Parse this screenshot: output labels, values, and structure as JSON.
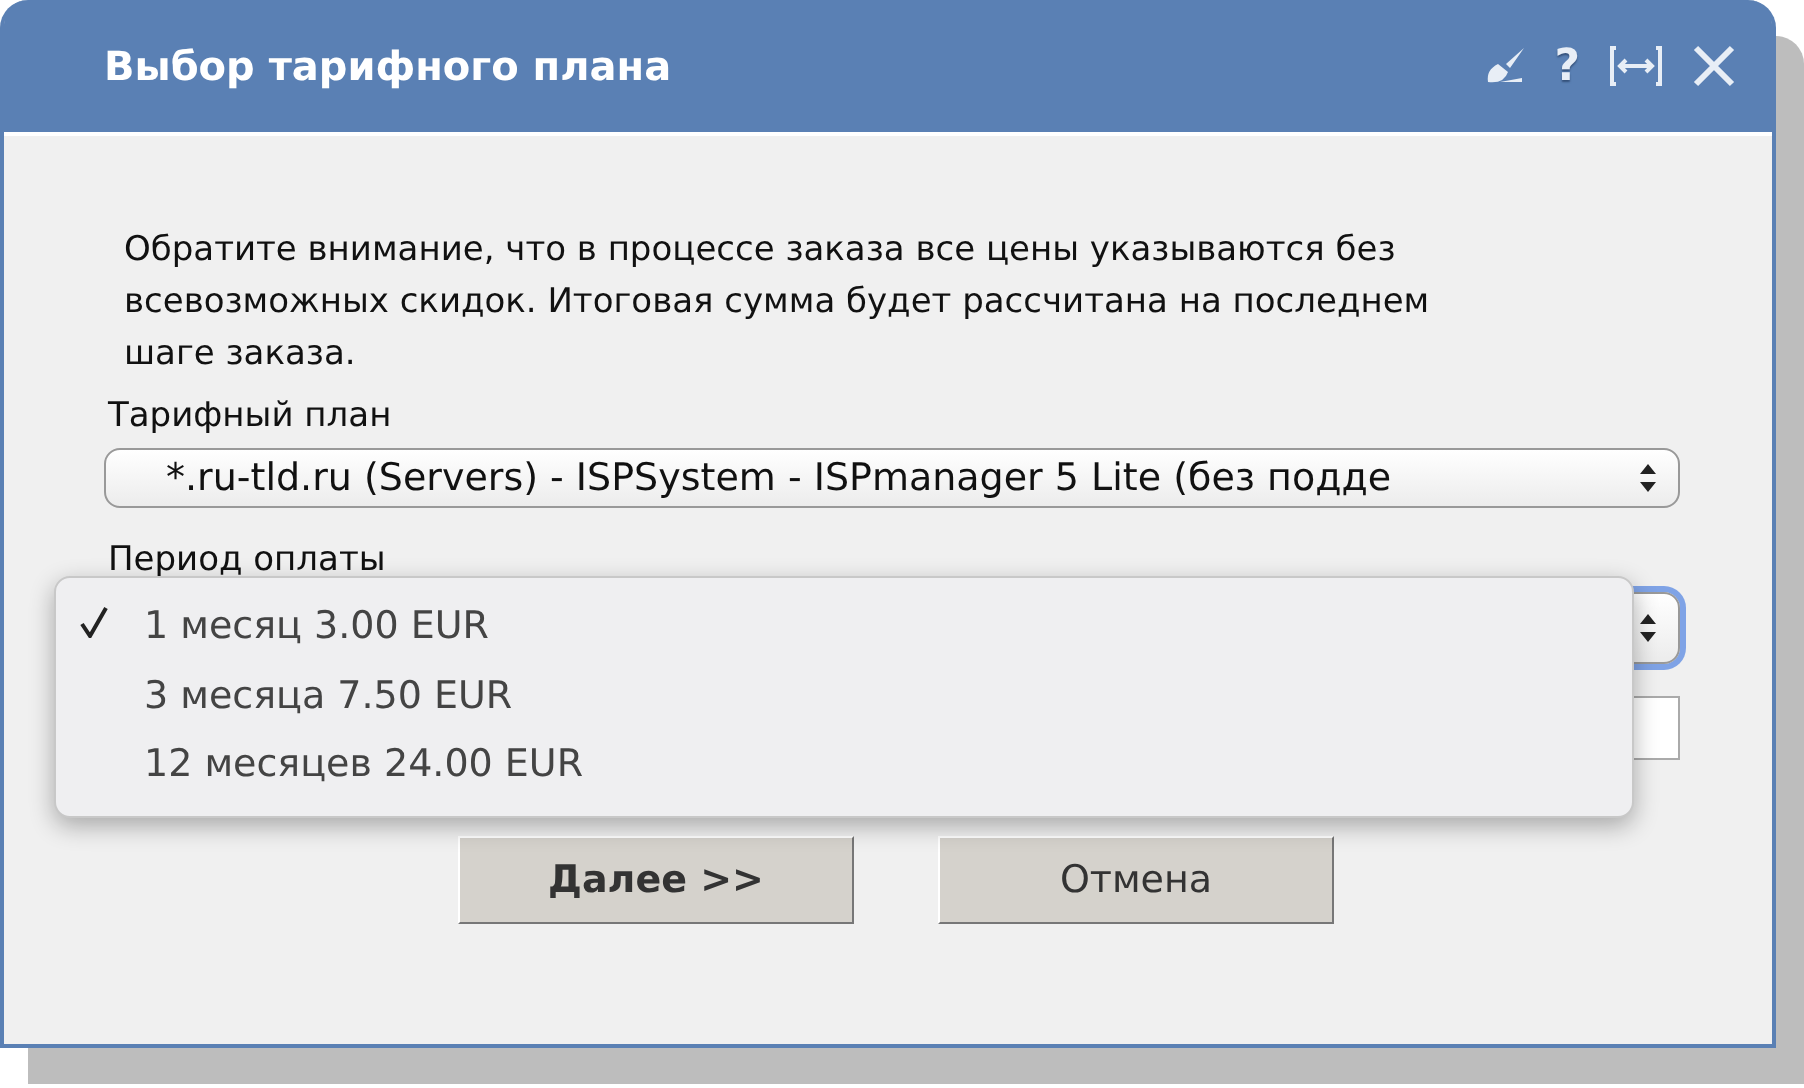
{
  "window": {
    "title": "Выбор тарифного плана",
    "help": "?"
  },
  "notice": "Обратите внимание, что в процессе заказа все цены указываются без всевозможных скидок. Итоговая сумма будет рассчитана на последнем шаге заказа.",
  "tariff": {
    "label": "Тарифный план",
    "value": "*.ru-tld.ru (Servers) - ISPSystem - ISPmanager 5 Lite (без подде"
  },
  "period": {
    "label": "Период оплаты",
    "expanded": true,
    "options": [
      {
        "label": "1 месяц 3.00 EUR",
        "selected": true
      },
      {
        "label": "3 месяца 7.50 EUR",
        "selected": false
      },
      {
        "label": "12 месяцев 24.00 EUR",
        "selected": false
      }
    ]
  },
  "buttons": [
    {
      "label": "Далее >>",
      "primary": true
    },
    {
      "label": "Отмена",
      "primary": false
    }
  ]
}
